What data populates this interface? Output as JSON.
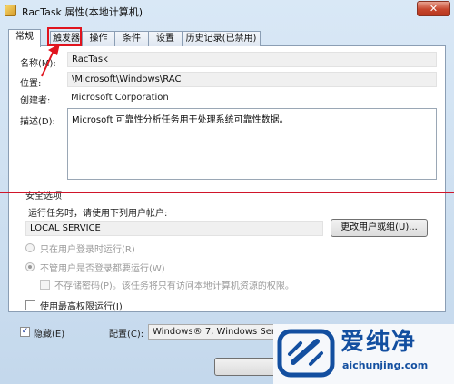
{
  "window": {
    "title": "RacTask 属性(本地计算机)",
    "close_glyph": "✕"
  },
  "tabs": [
    {
      "label": "常规",
      "active": true
    },
    {
      "label": "触发器",
      "active": false,
      "highlighted": true
    },
    {
      "label": "操作",
      "active": false
    },
    {
      "label": "条件",
      "active": false
    },
    {
      "label": "设置",
      "active": false
    },
    {
      "label": "历史记录(已禁用)",
      "active": false
    }
  ],
  "general": {
    "name_label": "名称(M):",
    "name_value": "RacTask",
    "location_label": "位置:",
    "location_value": "\\Microsoft\\Windows\\RAC",
    "author_label": "创建者:",
    "author_value": "Microsoft Corporation",
    "description_label": "描述(D):",
    "description_value": "Microsoft 可靠性分析任务用于处理系统可靠性数据。"
  },
  "security": {
    "section_label": "安全选项",
    "run_as_label": "运行任务时，请使用下列用户帐户:",
    "account_value": "LOCAL SERVICE",
    "change_user_button": "更改用户或组(U)...",
    "option_logged_on": "只在用户登录时运行(R)",
    "option_whether_logged_on": "不管用户是否登录都要运行(W)",
    "option_no_password": "不存储密码(P)。该任务将只有访问本地计算机资源的权限。",
    "highest_privileges": "使用最高权限运行(I)",
    "selected_option": "whether_logged_on"
  },
  "bottom": {
    "hidden_label": "隐藏(E)",
    "hidden_checked": true,
    "configure_label": "配置(C):",
    "configure_value": "Windows® 7, Windows Server™ 2008 R2"
  },
  "watermark": {
    "title": "爱纯净",
    "url": "aichunjing.com"
  },
  "colors": {
    "annotation_red": "#e0141e",
    "watermark_blue": "#134fa0"
  }
}
